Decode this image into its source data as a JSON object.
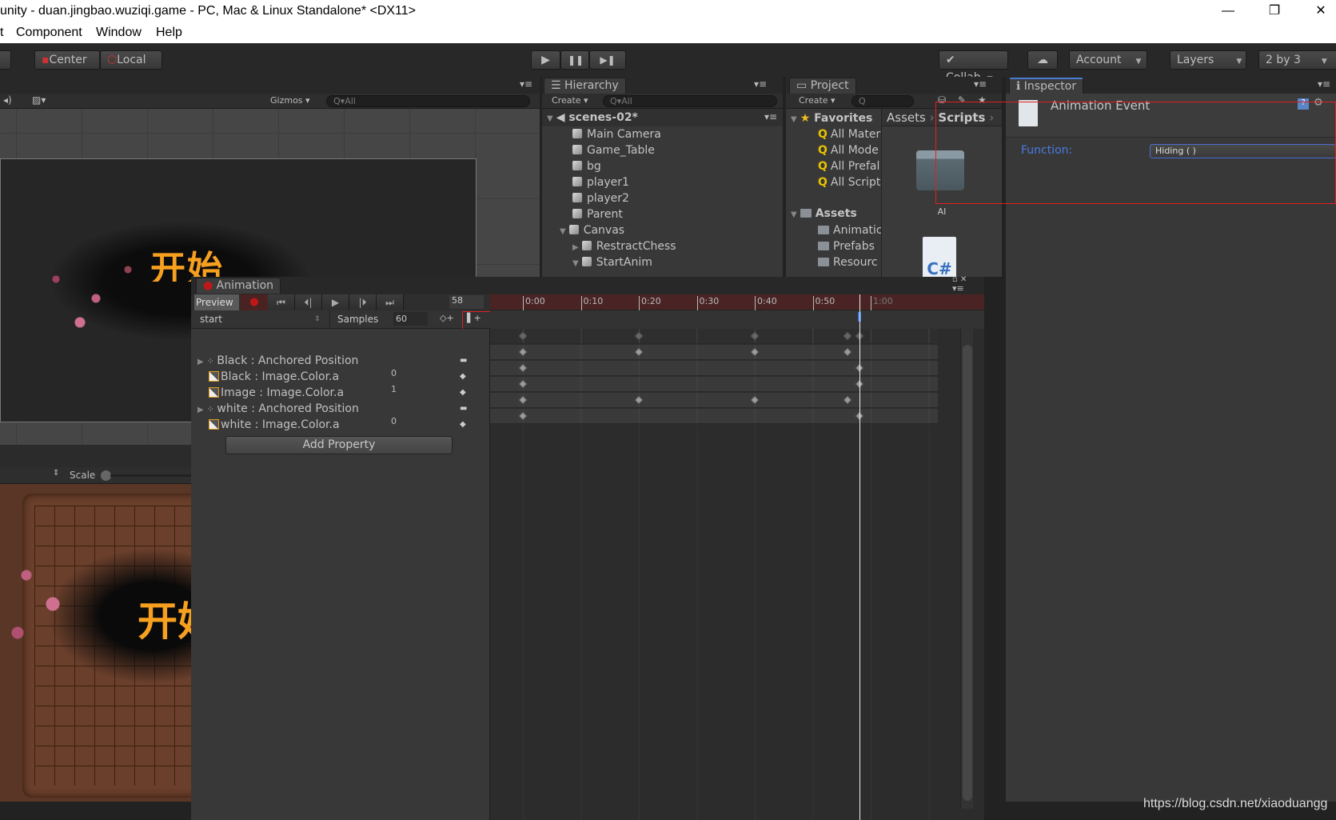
{
  "window": {
    "title": "unity - duan.jingbao.wuziqi.game - PC, Mac & Linux Standalone* <DX11>",
    "controls": [
      "—",
      "❐",
      "✕"
    ]
  },
  "menu": [
    "t",
    "Component",
    "Window",
    "Help"
  ],
  "toolbar": {
    "center": "Center",
    "local": "Local",
    "play": "▶",
    "pause": "❚❚",
    "step": "▶❚",
    "collab": "Collab",
    "cloud": "☁",
    "account": "Account",
    "layers": "Layers",
    "layout": "2 by 3"
  },
  "scene": {
    "gizmos": "Gizmos",
    "search_placeholder": "All",
    "game_text": "开始",
    "scale_label": "Scale"
  },
  "hierarchy": {
    "tab": "Hierarchy",
    "create": "Create",
    "search_placeholder": "All",
    "scene_name": "scenes-02*",
    "items": [
      {
        "label": "Main Camera"
      },
      {
        "label": "Game_Table"
      },
      {
        "label": "bg"
      },
      {
        "label": "player1"
      },
      {
        "label": "player2"
      },
      {
        "label": "Parent"
      },
      {
        "label": "Canvas"
      },
      {
        "label": "RestractChess"
      },
      {
        "label": "StartAnim"
      }
    ]
  },
  "project": {
    "tab": "Project",
    "create": "Create",
    "favorites": "Favorites",
    "favorite_items": [
      "All Mater",
      "All Mode",
      "All Prefal",
      "All Script"
    ],
    "assets": "Assets",
    "asset_folders": [
      "Animatic",
      "Prefabs",
      "Resourc"
    ],
    "breadcrumb": [
      "Assets",
      "Scripts"
    ],
    "grid_items": [
      {
        "label": "AI"
      }
    ]
  },
  "inspector": {
    "tab": "Inspector",
    "title": "Animation Event",
    "function_label": "Function:",
    "function_value": "Hiding ( )"
  },
  "animation": {
    "tab": "Animation",
    "preview": "Preview",
    "frame": "58",
    "clip": "start",
    "samples_label": "Samples",
    "samples": "60",
    "add_property": "Add Property",
    "ruler": [
      "0:00",
      "0:10",
      "0:20",
      "0:30",
      "0:40",
      "0:50",
      "1:00"
    ],
    "playhead_frame": 58,
    "properties": [
      {
        "label": "Black : Anchored Position",
        "value": "",
        "kind": "position",
        "keys": [
          0,
          20,
          40,
          56
        ]
      },
      {
        "label": "Black : Image.Color.a",
        "value": "0",
        "kind": "color",
        "keys": [
          0,
          58
        ]
      },
      {
        "label": "Image : Image.Color.a",
        "value": "1",
        "kind": "color",
        "keys": [
          0,
          58
        ]
      },
      {
        "label": "white : Anchored Position",
        "value": "",
        "kind": "position",
        "keys": [
          0,
          20,
          40,
          56
        ]
      },
      {
        "label": "white : Image.Color.a",
        "value": "0",
        "kind": "color",
        "keys": [
          0,
          58
        ]
      }
    ],
    "summary_keys": [
      0,
      20,
      40,
      56,
      58
    ]
  },
  "watermark": "https://blog.csdn.net/xiaoduangg",
  "colors": {
    "accent": "#4a7bd0",
    "record": "#c01818",
    "highlight": "#e02020"
  }
}
